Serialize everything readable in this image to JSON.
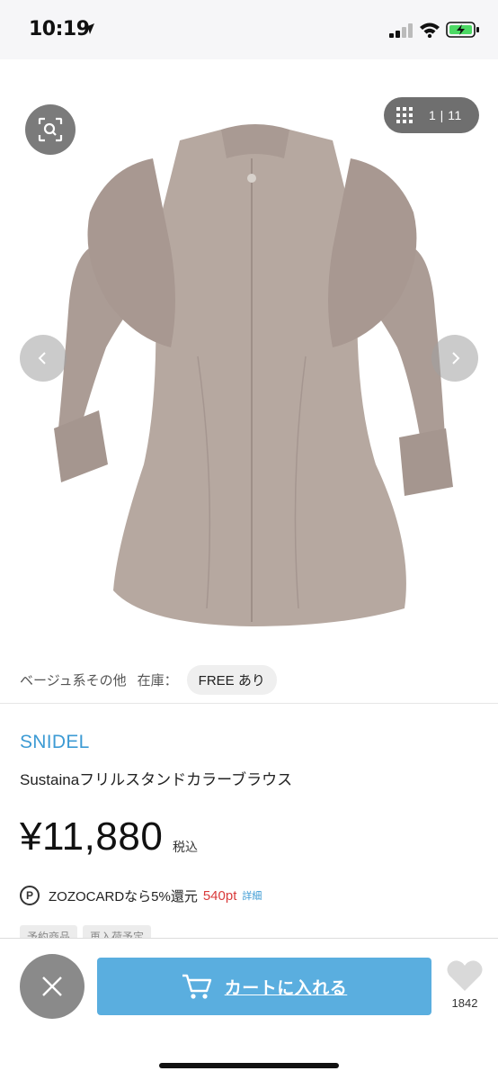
{
  "status_bar": {
    "time": "10:19"
  },
  "gallery": {
    "counter": "1 | 11",
    "product_image_alt": "beige frill stand collar blouse"
  },
  "stock": {
    "color": "ベージュ系その他",
    "label": "在庫：",
    "size_chip": "FREE あり"
  },
  "product": {
    "brand": "SNIDEL",
    "name": "Sustainaフリルスタンドカラーブラウス",
    "price": "¥11,880",
    "tax_note": "税込"
  },
  "points": {
    "icon_letter": "P",
    "text": "ZOZOCARDなら5%還元",
    "amount": "540pt",
    "detail_link": "詳細"
  },
  "tags": [
    "予約商品",
    "再入荷予定"
  ],
  "action_bar": {
    "cart_label": "カートに入れる",
    "favorite_count": "1842"
  },
  "colors": {
    "brand_link": "#3d9bd4",
    "cart_button": "#5aaedf",
    "points_red": "#d93b3b",
    "garment": "#b6a8a0"
  }
}
